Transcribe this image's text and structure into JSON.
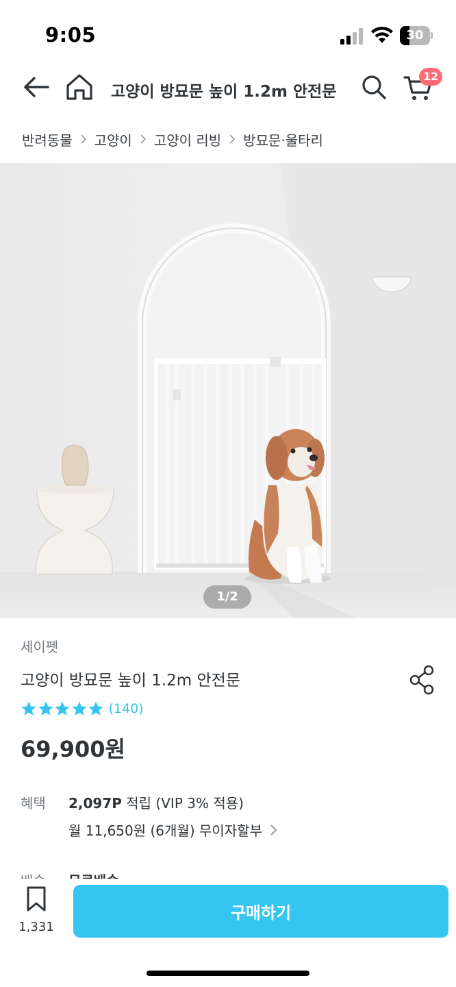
{
  "status_bar": {
    "time": "9:05",
    "battery": "30"
  },
  "nav": {
    "title": "고양이 방묘문 높이 1.2m 안전문",
    "cart_count": "12"
  },
  "breadcrumb": [
    "반려동물",
    "고양이",
    "고양이 리빙",
    "방묘문·울타리"
  ],
  "image": {
    "counter": "1/2"
  },
  "product": {
    "brand": "세이펫",
    "title": "고양이 방묘문 높이 1.2m 안전문",
    "rating": 5,
    "review_count": "(140)",
    "price": "69,900원"
  },
  "benefit": {
    "label": "혜택",
    "points": "2,097P",
    "points_suffix": " 적립 (VIP 3% 적용)",
    "installment": "월 11,650원 (6개월) 무이자할부"
  },
  "shipping": {
    "label": "배송",
    "value": "무료배송"
  },
  "bottom": {
    "bookmark_count": "1,331",
    "buy_label": "구매하기"
  },
  "colors": {
    "accent": "#35c5f0",
    "badge": "#ff6b74",
    "text": "#2f3438",
    "muted": "#757b81"
  }
}
